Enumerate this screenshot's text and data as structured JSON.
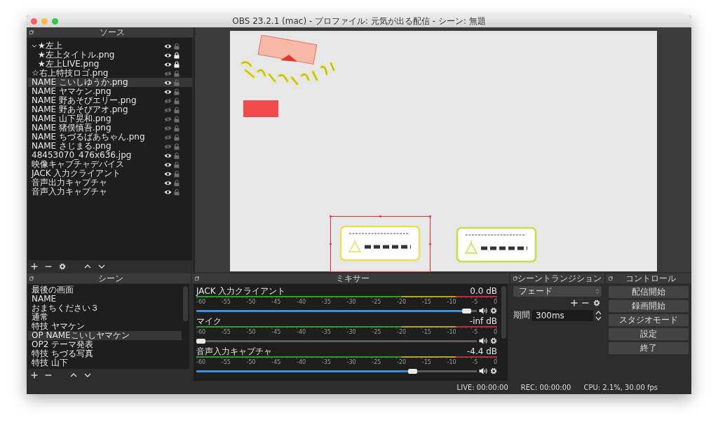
{
  "window": {
    "title": "OBS 23.2.1 (mac) - プロファイル: 元気が出る配信 - シーン: 無題"
  },
  "sources": {
    "title": "ソース",
    "items": [
      {
        "name": "★左上",
        "visible": true,
        "locked": false,
        "selected": false,
        "expanded": true,
        "children": [
          {
            "name": "★左上タイトル.png",
            "visible": true,
            "locked": true,
            "selected": false
          },
          {
            "name": "★左上LIVE.png",
            "visible": true,
            "locked": true,
            "selected": false
          }
        ]
      },
      {
        "name": "☆右上特技ロゴ.png",
        "visible": false,
        "locked": false,
        "selected": false
      },
      {
        "name": "NAME こいしゆうか.png",
        "visible": true,
        "locked": false,
        "selected": true
      },
      {
        "name": "NAME ヤマケン.png",
        "visible": true,
        "locked": false,
        "selected": false
      },
      {
        "name": "NAME 野あそびエリー.png",
        "visible": false,
        "locked": false,
        "selected": false
      },
      {
        "name": "NAME 野あそびアオ.png",
        "visible": false,
        "locked": false,
        "selected": false
      },
      {
        "name": "NAME 山下晃和.png",
        "visible": false,
        "locked": false,
        "selected": false
      },
      {
        "name": "NAME 猪俣慎吾.png",
        "visible": false,
        "locked": false,
        "selected": false
      },
      {
        "name": "NAME ちづるばあちゃん.png",
        "visible": false,
        "locked": false,
        "selected": false
      },
      {
        "name": "NAME さじまる.png",
        "visible": false,
        "locked": false,
        "selected": false
      },
      {
        "name": "48453070_476x636.jpg",
        "visible": true,
        "locked": false,
        "selected": false
      },
      {
        "name": "映像キャプチャデバイス",
        "visible": true,
        "locked": false,
        "selected": false
      },
      {
        "name": "JACK 入力クライアント",
        "visible": true,
        "locked": false,
        "selected": false
      },
      {
        "name": "音声出力キャプチャ",
        "visible": true,
        "locked": false,
        "selected": false
      },
      {
        "name": "音声入力キャプチャ",
        "visible": true,
        "locked": false,
        "selected": false
      }
    ]
  },
  "scenes": {
    "title": "シーン",
    "items": [
      {
        "name": "最後の画面",
        "selected": false
      },
      {
        "name": "NAME",
        "selected": false
      },
      {
        "name": "おまちください３",
        "selected": false
      },
      {
        "name": "通常",
        "selected": false
      },
      {
        "name": "特技 ヤマケン",
        "selected": false
      },
      {
        "name": "OP NAMEこいしヤマケン",
        "selected": true
      },
      {
        "name": "OP2 テーマ発表",
        "selected": false
      },
      {
        "name": "特技 ちづる写真",
        "selected": false
      },
      {
        "name": "特技 山下",
        "selected": false
      }
    ]
  },
  "mixer": {
    "title": "ミキサー",
    "channels": [
      {
        "name": "JACK 入力クライアント",
        "reading": "0.0 dB",
        "level": 0.98,
        "scale": [
          "-60",
          "-55",
          "-50",
          "-45",
          "-40",
          "-35",
          "-30",
          "-25",
          "-20",
          "-15",
          "-10",
          "-5",
          "0"
        ]
      },
      {
        "name": "マイク",
        "reading": "-inf dB",
        "level": 0.0,
        "scale": [
          "-60",
          "-55",
          "-50",
          "-45",
          "-40",
          "-35",
          "-30",
          "-25",
          "-20",
          "-15",
          "-10",
          "-5",
          "0"
        ]
      },
      {
        "name": "音声入力キャプチャ",
        "reading": "-4.4 dB",
        "level": 0.78,
        "scale": [
          "-60",
          "-55",
          "-50",
          "-45",
          "-40",
          "-35",
          "-30",
          "-25",
          "-20",
          "-15",
          "-10",
          "-5",
          "0"
        ]
      }
    ]
  },
  "transitions": {
    "title": "シーントランジション",
    "transition": "フェード",
    "duration_label": "期間",
    "duration": "300ms"
  },
  "controls": {
    "title": "コントロール",
    "buttons": [
      "配信開始",
      "録画開始",
      "スタジオモード",
      "設定",
      "終了"
    ]
  },
  "status_bar": [
    "LIVE: 00:00:00",
    "REC: 00:00:00",
    "CPU: 2.1%, 30.00 fps"
  ]
}
